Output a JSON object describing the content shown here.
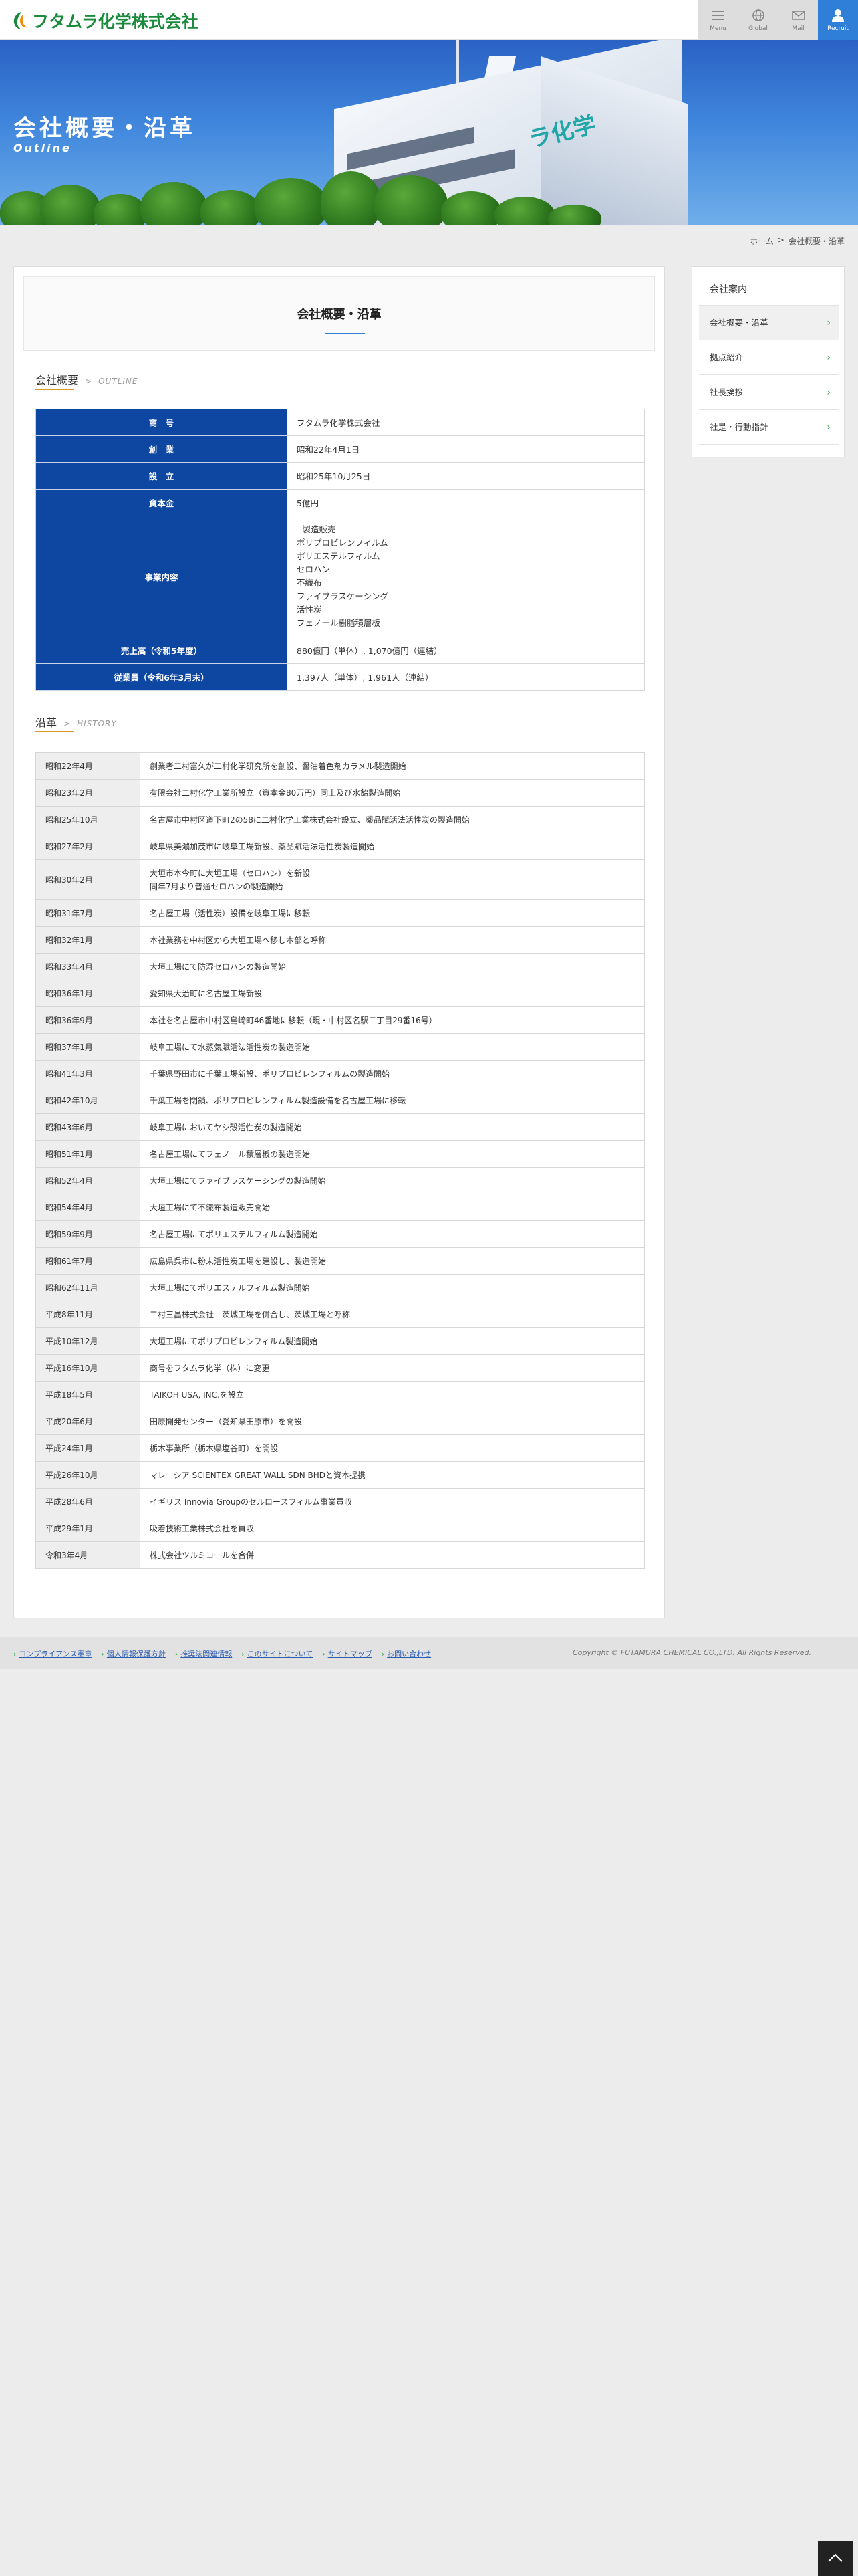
{
  "header": {
    "logo_text": "フタムラ化学株式会社",
    "nav": [
      {
        "label": "Menu",
        "icon": "menu-icon"
      },
      {
        "label": "Global",
        "icon": "globe-icon"
      },
      {
        "label": "Mail",
        "icon": "mail-icon"
      },
      {
        "label": "Recruit",
        "icon": "person-icon"
      }
    ]
  },
  "hero": {
    "title": "会社概要・沿革",
    "subtitle": "Outline",
    "building_sign": "ラ化学"
  },
  "breadcrumb": {
    "home": "ホーム",
    "separator": ">",
    "current": "会社概要・沿革"
  },
  "page": {
    "title": "会社概要・沿革"
  },
  "overview": {
    "title": "会社概要",
    "arrow": ">",
    "en": "OUTLINE",
    "rows": [
      {
        "label": "商　号",
        "value": "フタムラ化学株式会社"
      },
      {
        "label": "創　業",
        "value": "昭和22年4月1日"
      },
      {
        "label": "設　立",
        "value": "昭和25年10月25日"
      },
      {
        "label": "資本金",
        "value": "5億円"
      },
      {
        "label": "事業内容",
        "value": "- 製造販売\nポリプロピレンフィルム\nポリエステルフィルム\nセロハン\n不織布\nファイブラスケーシング\n活性炭\nフェノール樹脂積層板"
      },
      {
        "label": "売上高（令和5年度）",
        "value": "880億円（単体）, 1,070億円（連結）"
      },
      {
        "label": "従業員（令和6年3月末）",
        "value": "1,397人（単体）, 1,961人（連結）"
      }
    ]
  },
  "history": {
    "title": "沿革",
    "arrow": ">",
    "en": "HISTORY",
    "rows": [
      {
        "date": "昭和22年4月",
        "event": "創業者二村富久が二村化学研究所を創設、醤油着色剤カラメル製造開始"
      },
      {
        "date": "昭和23年2月",
        "event": "有限会社二村化学工業所設立（資本金80万円）同上及び水飴製造開始"
      },
      {
        "date": "昭和25年10月",
        "event": "名古屋市中村区道下町2の58に二村化学工業株式会社設立、薬品賦活法活性炭の製造開始"
      },
      {
        "date": "昭和27年2月",
        "event": "岐阜県美濃加茂市に岐阜工場新設、薬品賦活法活性炭製造開始"
      },
      {
        "date": "昭和30年2月",
        "event": "大垣市本今町に大垣工場（セロハン）を新設\n同年7月より普通セロハンの製造開始"
      },
      {
        "date": "昭和31年7月",
        "event": "名古屋工場（活性炭）設備を岐阜工場に移転"
      },
      {
        "date": "昭和32年1月",
        "event": "本社業務を中村区から大垣工場へ移し本部と呼称"
      },
      {
        "date": "昭和33年4月",
        "event": "大垣工場にて防湿セロハンの製造開始"
      },
      {
        "date": "昭和36年1月",
        "event": "愛知県大治町に名古屋工場新設"
      },
      {
        "date": "昭和36年9月",
        "event": "本社を名古屋市中村区島崎町46番地に移転（現・中村区名駅二丁目29番16号）"
      },
      {
        "date": "昭和37年1月",
        "event": "岐阜工場にて水蒸気賦活法活性炭の製造開始"
      },
      {
        "date": "昭和41年3月",
        "event": "千葉県野田市に千葉工場新設、ポリプロピレンフィルムの製造開始"
      },
      {
        "date": "昭和42年10月",
        "event": "千葉工場を閉鎖、ポリプロピレンフィルム製造設備を名古屋工場に移転"
      },
      {
        "date": "昭和43年6月",
        "event": "岐阜工場においてヤシ殻活性炭の製造開始"
      },
      {
        "date": "昭和51年1月",
        "event": "名古屋工場にてフェノール積層板の製造開始"
      },
      {
        "date": "昭和52年4月",
        "event": "大垣工場にてファイブラスケーシングの製造開始"
      },
      {
        "date": "昭和54年4月",
        "event": "大垣工場にて不織布製造販売開始"
      },
      {
        "date": "昭和59年9月",
        "event": "名古屋工場にてポリエステルフィルム製造開始"
      },
      {
        "date": "昭和61年7月",
        "event": "広島県呉市に粉末活性炭工場を建設し、製造開始"
      },
      {
        "date": "昭和62年11月",
        "event": "大垣工場にてポリエステルフィルム製造開始"
      },
      {
        "date": "平成8年11月",
        "event": "二村三昌株式会社　茨城工場を併合し、茨城工場と呼称"
      },
      {
        "date": "平成10年12月",
        "event": "大垣工場にてポリプロピレンフィルム製造開始"
      },
      {
        "date": "平成16年10月",
        "event": "商号をフタムラ化学（株）に変更"
      },
      {
        "date": "平成18年5月",
        "event": "TAIKOH USA, INC.を設立"
      },
      {
        "date": "平成20年6月",
        "event": "田原開発センター（愛知県田原市）を開設"
      },
      {
        "date": "平成24年1月",
        "event": "栃木事業所（栃木県塩谷町）を開設"
      },
      {
        "date": "平成26年10月",
        "event": "マレーシア SCIENTEX GREAT WALL SDN BHDと資本提携"
      },
      {
        "date": "平成28年6月",
        "event": "イギリス Innovia Groupのセルロースフィルム事業買収"
      },
      {
        "date": "平成29年1月",
        "event": "吸着技術工業株式会社を買収"
      },
      {
        "date": "令和3年4月",
        "event": "株式会社ツルミコールを合併"
      }
    ]
  },
  "sidebar": {
    "title": "会社案内",
    "items": [
      {
        "label": "会社概要・沿革"
      },
      {
        "label": "拠点紹介"
      },
      {
        "label": "社長挨拶"
      },
      {
        "label": "社是・行動指針"
      }
    ]
  },
  "footer": {
    "links": [
      "コンプライアンス憲章",
      "個人情報保護方針",
      "推奨法関連情報",
      "このサイトについて",
      "サイトマップ",
      "お問い合わせ"
    ],
    "copyright": "Copyright © FUTAMURA CHEMICAL CO.,LTD. All Rights Reserved."
  },
  "colors": {
    "brand_green": "#1a8a3c",
    "accent_blue": "#0e47a1",
    "recruit_blue": "#2f7fd8",
    "section_underline": "#d99a2b"
  }
}
